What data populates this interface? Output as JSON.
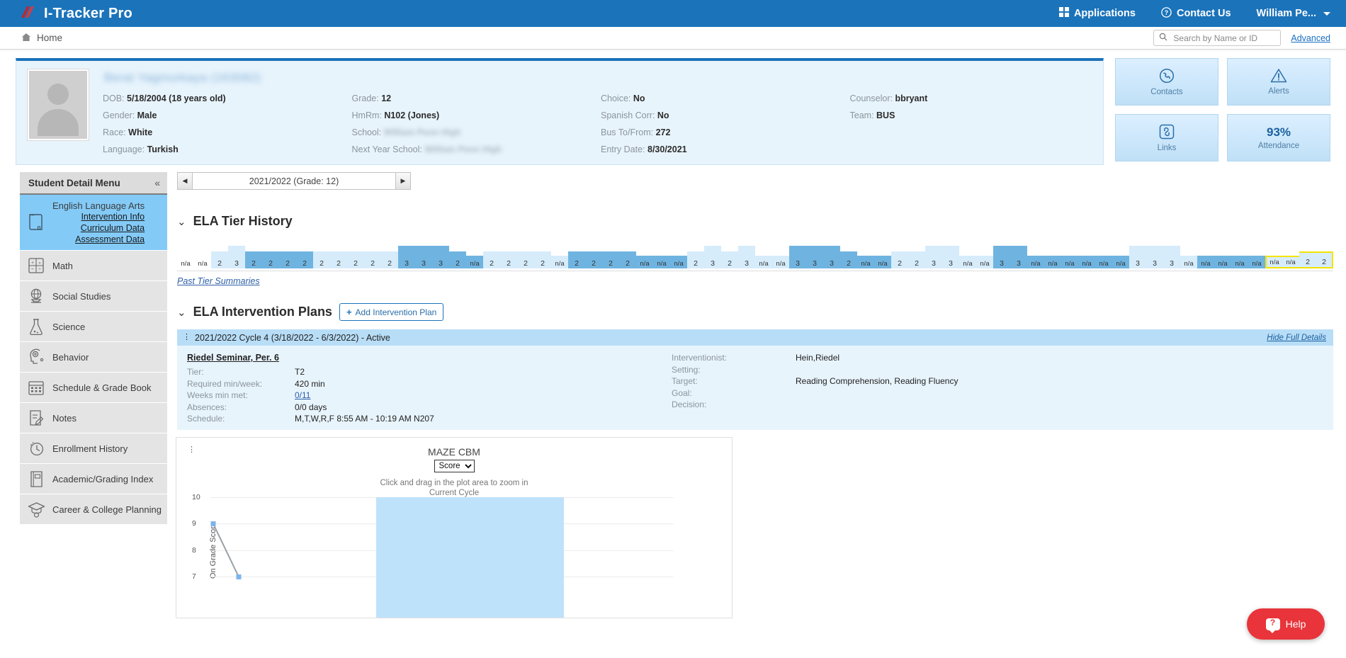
{
  "topnav": {
    "brand": "I-Tracker Pro",
    "applications": "Applications",
    "contact_us": "Contact Us",
    "user": "William Pe...",
    "accent_color": "#1b73ba"
  },
  "crumbbar": {
    "home": "Home",
    "search_placeholder": "Search by Name or ID",
    "search_value": "",
    "advanced": "Advanced"
  },
  "student": {
    "name": "Berat Yagmurkaya (163082)",
    "name_redacted": true,
    "fields": [
      {
        "label": "DOB:",
        "value": "5/18/2004 (18 years old)",
        "redacted": false
      },
      {
        "label": "Grade:",
        "value": "12",
        "redacted": false
      },
      {
        "label": "Choice:",
        "value": "No",
        "redacted": false
      },
      {
        "label": "Counselor:",
        "value": "bbryant",
        "redacted": false
      },
      {
        "label": "Gender:",
        "value": "Male",
        "redacted": false
      },
      {
        "label": "HmRm:",
        "value": "N102 (Jones)",
        "redacted": false
      },
      {
        "label": "Spanish Corr:",
        "value": "No",
        "redacted": false
      },
      {
        "label": "Team:",
        "value": "BUS",
        "redacted": false
      },
      {
        "label": "Race:",
        "value": "White",
        "redacted": false
      },
      {
        "label": "School:",
        "value": "William Penn High",
        "redacted": true
      },
      {
        "label": "Bus To/From:",
        "value": "272",
        "redacted": false
      },
      {
        "label": "",
        "value": "",
        "redacted": false
      },
      {
        "label": "Language:",
        "value": "Turkish",
        "redacted": false
      },
      {
        "label": "Next Year School:",
        "value": "William Penn High",
        "redacted": true
      },
      {
        "label": "Entry Date:",
        "value": "8/30/2021",
        "redacted": false
      },
      {
        "label": "",
        "value": "",
        "redacted": false
      }
    ]
  },
  "tiles": [
    {
      "label": "Contacts",
      "icon": "phone-icon",
      "big": ""
    },
    {
      "label": "Alerts",
      "icon": "warning-icon",
      "big": ""
    },
    {
      "label": "Links",
      "icon": "link-icon",
      "big": ""
    },
    {
      "label": "Attendance",
      "icon": "",
      "big": "93%"
    }
  ],
  "sidebar": {
    "title": "Student Detail Menu",
    "collapse_icon": "«",
    "items": [
      {
        "label": "English Language Arts",
        "icon": "book-icon",
        "active": true,
        "sublinks": [
          "Intervention Info",
          "Curriculum Data",
          "Assessment Data"
        ]
      },
      {
        "label": "Math",
        "icon": "calculator-icon",
        "active": false,
        "sublinks": []
      },
      {
        "label": "Social Studies",
        "icon": "globe-icon",
        "active": false,
        "sublinks": []
      },
      {
        "label": "Science",
        "icon": "flask-icon",
        "active": false,
        "sublinks": []
      },
      {
        "label": "Behavior",
        "icon": "head-gear-icon",
        "active": false,
        "sublinks": []
      },
      {
        "label": "Schedule & Grade Book",
        "icon": "calendar-icon",
        "active": false,
        "sublinks": []
      },
      {
        "label": "Notes",
        "icon": "note-pencil-icon",
        "active": false,
        "sublinks": []
      },
      {
        "label": "Enrollment History",
        "icon": "clock-history-icon",
        "active": false,
        "sublinks": []
      },
      {
        "label": "Academic/Grading Index",
        "icon": "book-closed-icon",
        "active": false,
        "sublinks": []
      },
      {
        "label": "Career & College Planning",
        "icon": "graduation-cap-icon",
        "active": false,
        "sublinks": []
      }
    ]
  },
  "main": {
    "year_selector": {
      "value": "2021/2022 (Grade: 12)",
      "prev_icon": "◀",
      "next_icon": "▶"
    },
    "tier_history": {
      "title": "ELA Tier History",
      "past_link": "Past Tier Summaries",
      "cells": [
        {
          "v": "n/a",
          "h": 0,
          "c": "none"
        },
        {
          "v": "n/a",
          "h": 0,
          "c": "none"
        },
        {
          "v": "2",
          "h": 10,
          "c": "light"
        },
        {
          "v": "3",
          "h": 18,
          "c": "light"
        },
        {
          "v": "2",
          "h": 10,
          "c": "mid"
        },
        {
          "v": "2",
          "h": 10,
          "c": "mid"
        },
        {
          "v": "2",
          "h": 10,
          "c": "mid"
        },
        {
          "v": "2",
          "h": 10,
          "c": "mid"
        },
        {
          "v": "2",
          "h": 10,
          "c": "light"
        },
        {
          "v": "2",
          "h": 10,
          "c": "light"
        },
        {
          "v": "2",
          "h": 10,
          "c": "light"
        },
        {
          "v": "2",
          "h": 10,
          "c": "light"
        },
        {
          "v": "2",
          "h": 10,
          "c": "light"
        },
        {
          "v": "3",
          "h": 18,
          "c": "mid"
        },
        {
          "v": "3",
          "h": 18,
          "c": "mid"
        },
        {
          "v": "3",
          "h": 18,
          "c": "mid"
        },
        {
          "v": "2",
          "h": 10,
          "c": "mid"
        },
        {
          "v": "n/a",
          "h": 4,
          "c": "mid"
        },
        {
          "v": "2",
          "h": 10,
          "c": "light"
        },
        {
          "v": "2",
          "h": 10,
          "c": "light"
        },
        {
          "v": "2",
          "h": 10,
          "c": "light"
        },
        {
          "v": "2",
          "h": 10,
          "c": "light"
        },
        {
          "v": "n/a",
          "h": 4,
          "c": "light"
        },
        {
          "v": "2",
          "h": 10,
          "c": "mid"
        },
        {
          "v": "2",
          "h": 10,
          "c": "mid"
        },
        {
          "v": "2",
          "h": 10,
          "c": "mid"
        },
        {
          "v": "2",
          "h": 10,
          "c": "mid"
        },
        {
          "v": "n/a",
          "h": 4,
          "c": "mid"
        },
        {
          "v": "n/a",
          "h": 4,
          "c": "mid"
        },
        {
          "v": "n/a",
          "h": 4,
          "c": "mid"
        },
        {
          "v": "2",
          "h": 10,
          "c": "light"
        },
        {
          "v": "3",
          "h": 18,
          "c": "light"
        },
        {
          "v": "2",
          "h": 10,
          "c": "light"
        },
        {
          "v": "3",
          "h": 18,
          "c": "light"
        },
        {
          "v": "n/a",
          "h": 4,
          "c": "light"
        },
        {
          "v": "n/a",
          "h": 4,
          "c": "light"
        },
        {
          "v": "3",
          "h": 18,
          "c": "mid"
        },
        {
          "v": "3",
          "h": 18,
          "c": "mid"
        },
        {
          "v": "3",
          "h": 18,
          "c": "mid"
        },
        {
          "v": "2",
          "h": 10,
          "c": "mid"
        },
        {
          "v": "n/a",
          "h": 4,
          "c": "mid"
        },
        {
          "v": "n/a",
          "h": 4,
          "c": "mid"
        },
        {
          "v": "2",
          "h": 10,
          "c": "light"
        },
        {
          "v": "2",
          "h": 10,
          "c": "light"
        },
        {
          "v": "3",
          "h": 18,
          "c": "light"
        },
        {
          "v": "3",
          "h": 18,
          "c": "light"
        },
        {
          "v": "n/a",
          "h": 4,
          "c": "light"
        },
        {
          "v": "n/a",
          "h": 4,
          "c": "light"
        },
        {
          "v": "3",
          "h": 18,
          "c": "mid"
        },
        {
          "v": "3",
          "h": 18,
          "c": "mid"
        },
        {
          "v": "n/a",
          "h": 4,
          "c": "mid"
        },
        {
          "v": "n/a",
          "h": 4,
          "c": "mid"
        },
        {
          "v": "n/a",
          "h": 4,
          "c": "mid"
        },
        {
          "v": "n/a",
          "h": 4,
          "c": "mid"
        },
        {
          "v": "n/a",
          "h": 4,
          "c": "mid"
        },
        {
          "v": "n/a",
          "h": 4,
          "c": "mid"
        },
        {
          "v": "3",
          "h": 18,
          "c": "light"
        },
        {
          "v": "3",
          "h": 18,
          "c": "light"
        },
        {
          "v": "3",
          "h": 18,
          "c": "light"
        },
        {
          "v": "n/a",
          "h": 4,
          "c": "light"
        },
        {
          "v": "n/a",
          "h": 4,
          "c": "mid"
        },
        {
          "v": "n/a",
          "h": 4,
          "c": "mid"
        },
        {
          "v": "n/a",
          "h": 4,
          "c": "mid"
        },
        {
          "v": "n/a",
          "h": 4,
          "c": "mid"
        },
        {
          "v": "n/a",
          "h": 4,
          "c": "current"
        },
        {
          "v": "n/a",
          "h": 4,
          "c": "current"
        },
        {
          "v": "2",
          "h": 10,
          "c": "current"
        },
        {
          "v": "2",
          "h": 10,
          "c": "current"
        }
      ]
    },
    "plans": {
      "title": "ELA Intervention Plans",
      "add_button": "Add Intervention Plan",
      "plan_header": "2021/2022  Cycle 4 (3/18/2022 - 6/3/2022) - Active",
      "hide_details": "Hide Full Details",
      "plan_name": "Riedel Seminar, Per. 6",
      "left_rows": [
        {
          "label": "Tier:",
          "value": "T2",
          "link": false
        },
        {
          "label": "Required min/week:",
          "value": "420 min",
          "link": false
        },
        {
          "label": "Weeks min met:",
          "value": "0/11",
          "link": true
        },
        {
          "label": "Absences:",
          "value": "0/0 days",
          "link": false
        },
        {
          "label": "Schedule:",
          "value": "M,T,W,R,F  8:55 AM - 10:19 AM  N207",
          "link": false
        }
      ],
      "right_rows": [
        {
          "label": "Interventionist:",
          "value": "Hein,Riedel"
        },
        {
          "label": "Setting:",
          "value": ""
        },
        {
          "label": "Target:",
          "value": "Reading Comprehension, Reading Fluency"
        },
        {
          "label": "Goal:",
          "value": ""
        },
        {
          "label": "Decision:",
          "value": ""
        }
      ]
    }
  },
  "chart_data": {
    "type": "line",
    "title": "MAZE CBM",
    "metric_select": "Score",
    "hint": "Click and drag in the plot area to zoom in",
    "band_label": "Current Cycle",
    "xlabel": "",
    "ylabel": "On Grade Score",
    "ylim": [
      6,
      10
    ],
    "yticks": [
      10,
      9,
      8,
      7
    ],
    "grid": true,
    "series": [
      {
        "name": "Score",
        "x": [
          0,
          1
        ],
        "values": [
          9,
          7
        ],
        "color": "#7cb5ec"
      }
    ],
    "annotations": [
      {
        "type": "band",
        "label": "Current Cycle",
        "color": "#bfe2fb"
      }
    ]
  },
  "help": {
    "label": "Help",
    "icon": "help-icon",
    "color": "#e8343a"
  }
}
